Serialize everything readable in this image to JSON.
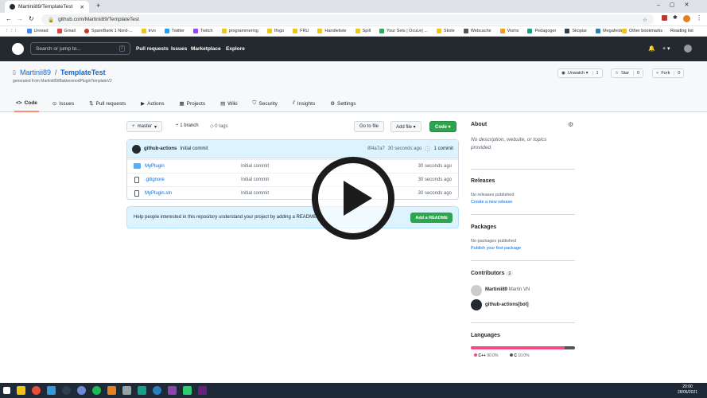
{
  "browser": {
    "tab_title": "Martinii89/TemplateTest",
    "url": "github.com/Martinii89/TemplateTest",
    "bookmarks": [
      "Unread",
      "Gmail",
      "SpareBank 1 Nord-...",
      "trvo",
      "Twitter",
      "Twitch",
      "programmering",
      "Ifngo",
      "FRU",
      "Handleliste",
      "Spill",
      "Your Sets | OcuLe| ...",
      "Skole",
      "Webcache",
      "Vismx",
      "Pedagoger",
      "Skopiar",
      "Megafeide"
    ],
    "other_bookmarks": "Other bookmarks",
    "reading_list": "Reading list"
  },
  "github": {
    "search_placeholder": "Search or jump to...",
    "search_key": "/",
    "nav": [
      "Pull requests",
      "Issues",
      "Marketplace",
      "Explore"
    ],
    "plus": "+ ▾"
  },
  "repo": {
    "owner": "Martinii89",
    "name": "TemplateTest",
    "generated_from": "generated from Martinii89/BakkesmodPluginTemplateV2",
    "unwatch_label": "Unwatch ▾",
    "unwatch_count": "1",
    "star_label": "Star",
    "star_count": "0",
    "fork_label": "Fork",
    "fork_count": "0",
    "tabs": [
      {
        "label": "Code"
      },
      {
        "label": "Issues"
      },
      {
        "label": "Pull requests"
      },
      {
        "label": "Actions"
      },
      {
        "label": "Projects"
      },
      {
        "label": "Wiki"
      },
      {
        "label": "Security"
      },
      {
        "label": "Insights"
      },
      {
        "label": "Settings"
      }
    ]
  },
  "files": {
    "branch": "master",
    "branches": "1 branch",
    "tags": "0 tags",
    "goto_file": "Go to file",
    "add_file": "Add file ▾",
    "code": "Code ▾",
    "commit_author": "github-actions",
    "commit_msg": "Initial commit",
    "commit_hash": "8f4a7a7",
    "commit_age": "30 seconds ago",
    "commit_count": "1 commit",
    "rows": [
      {
        "name": "MyPlugin",
        "msg": "Initial commit",
        "age": "30 seconds ago"
      },
      {
        "name": ".gitignore",
        "msg": "Initial commit",
        "age": "30 seconds ago"
      },
      {
        "name": "MyPlugin.sln",
        "msg": "Initial commit",
        "age": "30 seconds ago"
      }
    ],
    "readme_text": "Help people interested in this repository understand your project by adding a README.",
    "readme_button": "Add a README"
  },
  "sidebar": {
    "about": "About",
    "about_text": "No description, website, or topics provided.",
    "releases": "Releases",
    "releases_none": "No releases published",
    "releases_link": "Create a new release",
    "packages": "Packages",
    "packages_none": "No packages published",
    "packages_link": "Publish your first package",
    "contributors": "Contributors",
    "contributors_count": "2",
    "contrib1_name": "Martinii89",
    "contrib1_full": "Martin VN",
    "contrib2_name": "github-actions[bot]",
    "languages": "Languages",
    "lang": [
      {
        "name": "C++",
        "pct": "90.0%",
        "color": "#f34b7d",
        "value": 0.9
      },
      {
        "name": "C",
        "pct": "10.0%",
        "color": "#555555",
        "value": 0.1
      }
    ]
  },
  "taskbar": {
    "time": "20:00",
    "date": "28/06/2021"
  },
  "colors": {
    "accent": "#2da44e",
    "header": "#24292f",
    "link": "#0969da"
  }
}
